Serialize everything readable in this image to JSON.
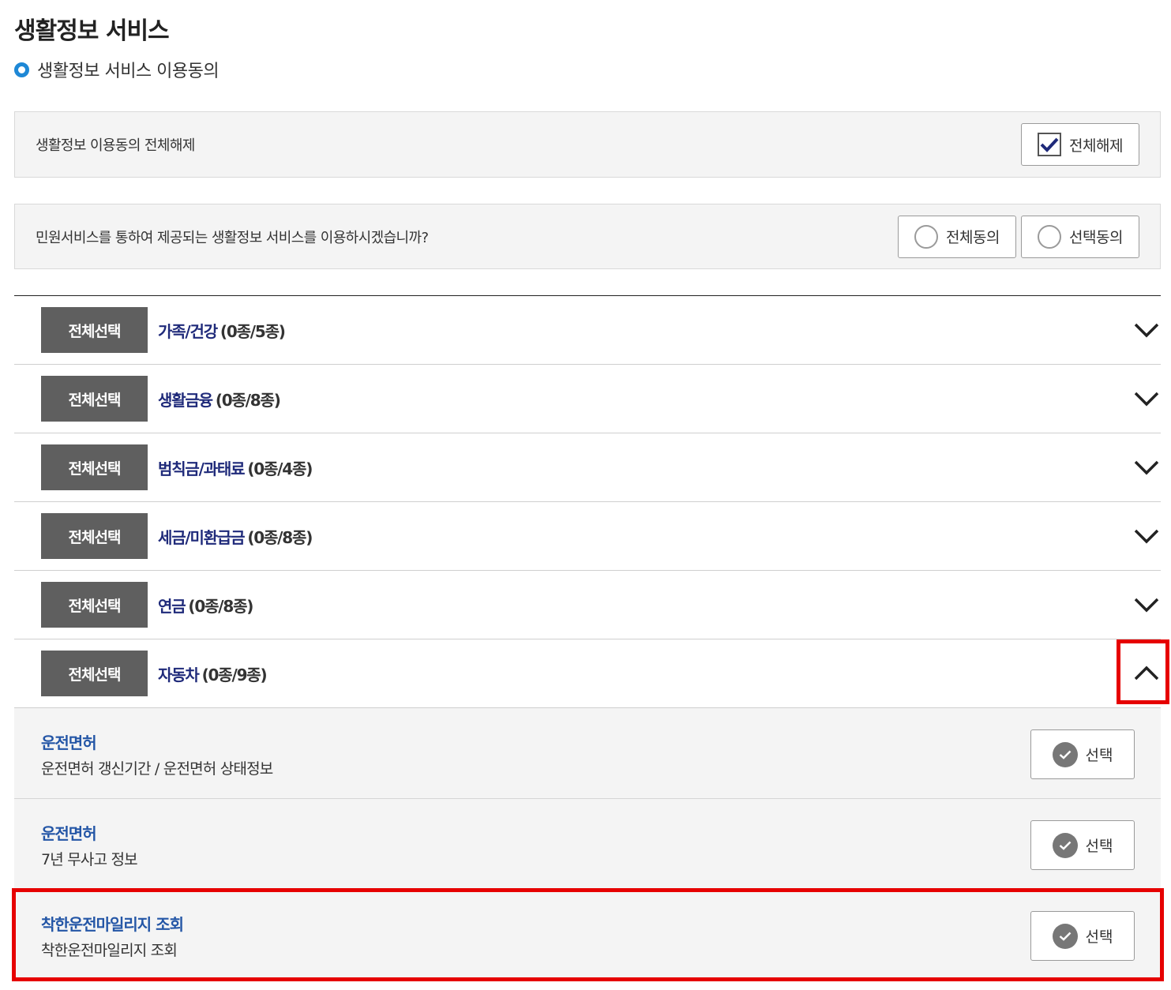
{
  "page": {
    "title": "생활정보 서비스",
    "subtitle": "생활정보 서비스 이용동의"
  },
  "release_all": {
    "text": "생활정보 이용동의 전체해제",
    "button_label": "전체해제"
  },
  "consent": {
    "question": "민원서비스를 통하여 제공되는 생활정보 서비스를 이용하시겠습니까?",
    "agree_all_label": "전체동의",
    "agree_selected_label": "선택동의"
  },
  "categories": [
    {
      "select_all_label": "전체선택",
      "name": "가족/건강",
      "count": "(0종/5종)",
      "expanded": false
    },
    {
      "select_all_label": "전체선택",
      "name": "생활금융",
      "count": "(0종/8종)",
      "expanded": false
    },
    {
      "select_all_label": "전체선택",
      "name": "범칙금/과태료",
      "count": "(0종/4종)",
      "expanded": false
    },
    {
      "select_all_label": "전체선택",
      "name": "세금/미환급금",
      "count": "(0종/8종)",
      "expanded": false
    },
    {
      "select_all_label": "전체선택",
      "name": "연금",
      "count": "(0종/8종)",
      "expanded": false
    },
    {
      "select_all_label": "전체선택",
      "name": "자동차",
      "count": "(0종/9종)",
      "expanded": true
    }
  ],
  "services": [
    {
      "title": "운전면허",
      "description": "운전면허 갱신기간 / 운전면허 상태정보",
      "button_label": "선택"
    },
    {
      "title": "운전면허",
      "description": "7년 무사고 정보",
      "button_label": "선택"
    },
    {
      "title": "착한운전마일리지 조회",
      "description": "착한운전마일리지 조회",
      "button_label": "선택"
    }
  ],
  "colors": {
    "accent_blue": "#1e88d6",
    "category_name": "#1f2a7a",
    "service_title": "#2456a6",
    "select_all_bg": "#5f5f5f",
    "highlight": "#e60000"
  }
}
